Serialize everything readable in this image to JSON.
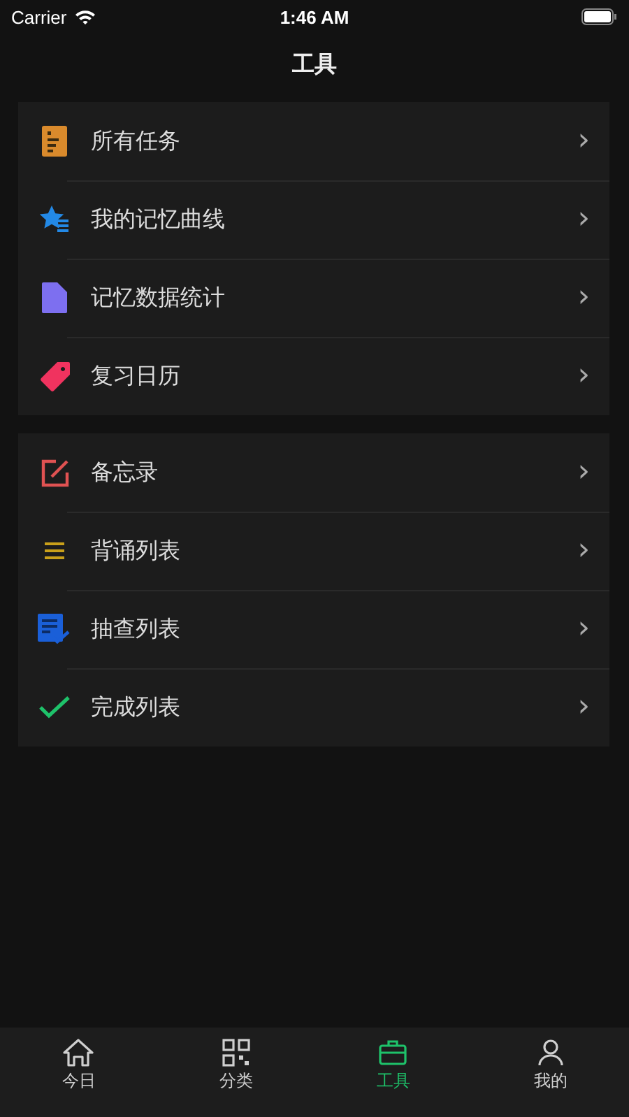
{
  "status_bar": {
    "carrier": "Carrier",
    "time": "1:46 AM"
  },
  "nav": {
    "title": "工具"
  },
  "groups": [
    {
      "items": [
        {
          "label": "所有任务",
          "chevron": "›"
        },
        {
          "label": "我的记忆曲线",
          "chevron": "›"
        },
        {
          "label": "记忆数据统计",
          "chevron": "›"
        },
        {
          "label": "复习日历",
          "chevron": "›"
        }
      ]
    },
    {
      "items": [
        {
          "label": "备忘录",
          "chevron": "›"
        },
        {
          "label": "背诵列表",
          "chevron": "›"
        },
        {
          "label": "抽查列表",
          "chevron": "›"
        },
        {
          "label": "完成列表",
          "chevron": "›"
        }
      ]
    }
  ],
  "tab_bar": [
    {
      "label": "今日",
      "selected": false
    },
    {
      "label": "分类",
      "selected": false
    },
    {
      "label": "工具",
      "selected": true
    },
    {
      "label": "我的",
      "selected": false
    }
  ]
}
